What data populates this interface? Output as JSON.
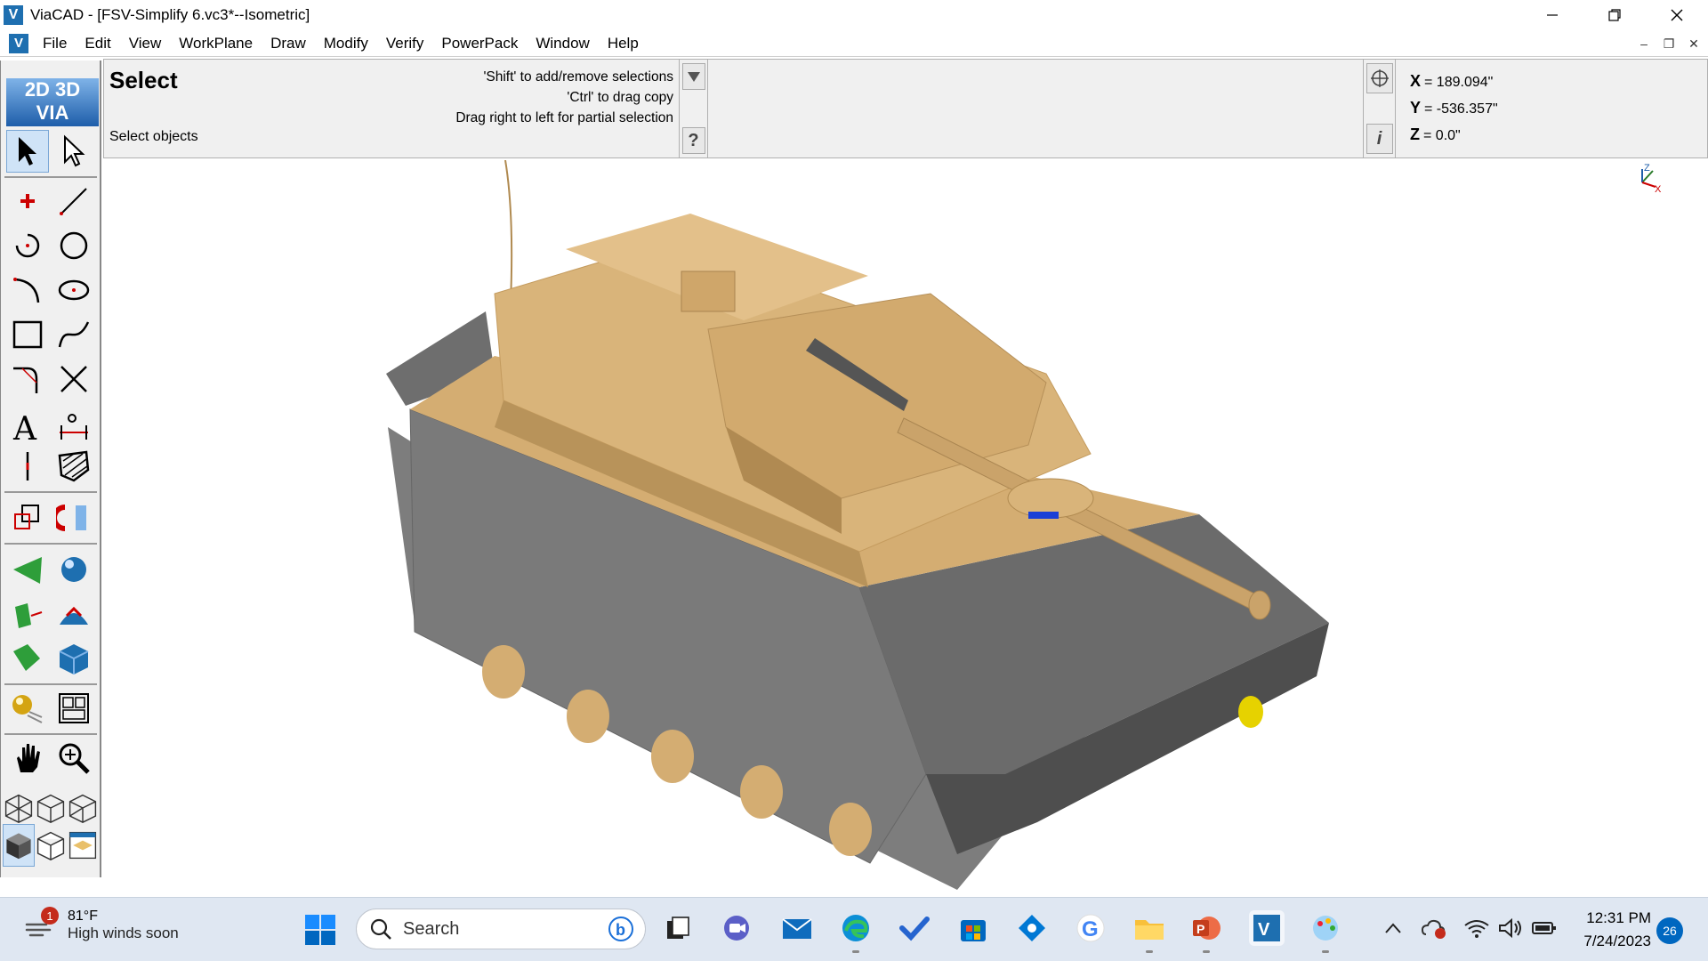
{
  "window": {
    "title": "ViaCAD - [FSV-Simplify 6.vc3*--Isometric]",
    "app_icon": "viacad-logo-icon"
  },
  "menu": {
    "items": [
      "File",
      "Edit",
      "View",
      "WorkPlane",
      "Draw",
      "Modify",
      "Verify",
      "PowerPack",
      "Window",
      "Help"
    ]
  },
  "prompt": {
    "command": "Select",
    "subprompt": "Select objects",
    "hints": [
      "'Shift' to add/remove selections",
      "'Ctrl' to drag copy",
      "Drag right to left for partial selection"
    ],
    "help_label": "?"
  },
  "coords": {
    "x_label": "X",
    "x_value": "= 189.094\"",
    "y_label": "Y",
    "y_value": "= -536.357\"",
    "z_label": "Z",
    "z_value": "= 0.0\"",
    "info_label": "i"
  },
  "toolbar": {
    "logo_line1": "2D  3D",
    "logo_line2": "VIA"
  },
  "viewport": {
    "axis_labels": {
      "z": "Z",
      "x": "X"
    },
    "colors": {
      "hull": "#7a7a7a",
      "hull_dark": "#5f5f5f",
      "body": "#d9b47a",
      "body_dark": "#b8935a",
      "tread": "#8a8a8a",
      "accent": "#1a3fd6"
    }
  },
  "taskbar": {
    "weather_temp": "81°F",
    "weather_desc": "High winds soon",
    "weather_badge": "1",
    "search_label": "Search",
    "time": "12:31 PM",
    "date": "7/24/2023",
    "notifications": "26"
  }
}
